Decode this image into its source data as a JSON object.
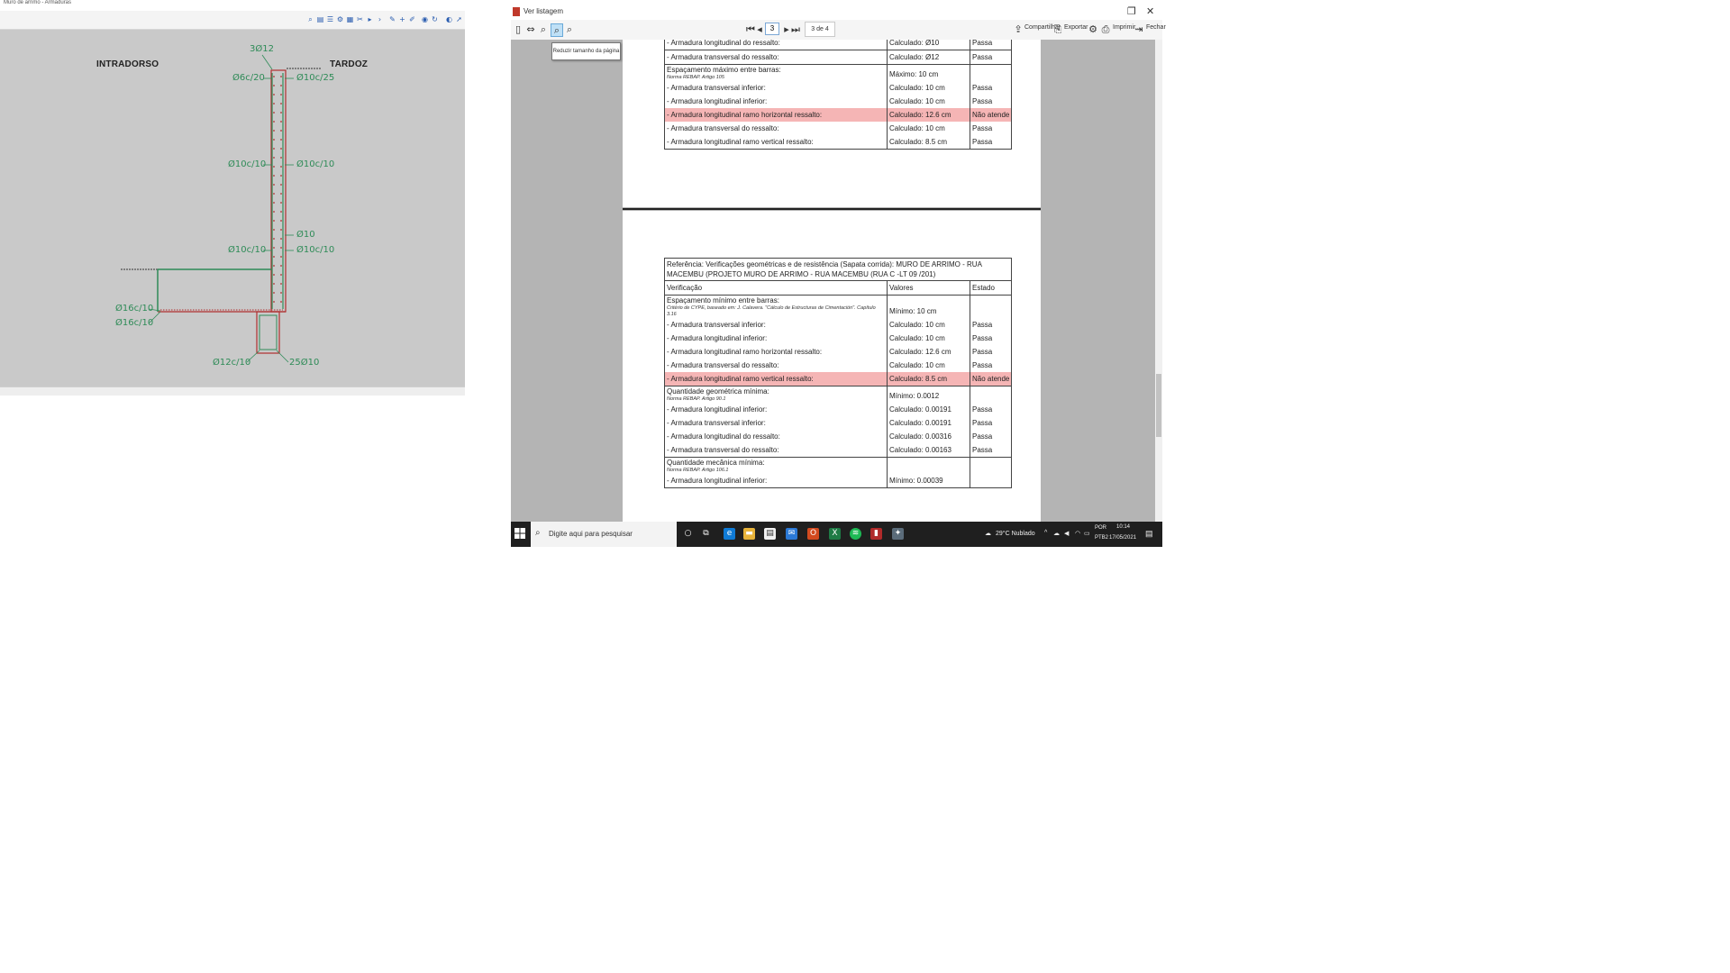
{
  "cad": {
    "window_title": "Muro de arrimo - Armaduras",
    "side_left": "INTRADORSO",
    "side_right": "TARDOZ",
    "labels": {
      "top_bars": "3Ø12",
      "stem_top_left": "Ø6c/20",
      "stem_top_right": "Ø10c/25",
      "stem_mid_left": "Ø10c/10",
      "stem_mid_right": "Ø10c/10",
      "stem_bar": "Ø10",
      "stem_low_left": "Ø10c/10",
      "stem_low_right": "Ø10c/10",
      "footing_1": "Ø16c/10",
      "footing_2": "Ø16c/10",
      "key_left": "Ø12c/10",
      "key_right": "25Ø10"
    },
    "colors": {
      "canvas": "#c9c9c9",
      "rebar": "#2e8b57",
      "concrete": "#b03030"
    }
  },
  "viewer": {
    "title": "Ver listagem",
    "current_page": "3",
    "page_count": "3 de 4",
    "tooltip": "Reduzir tamanho da página",
    "actions": {
      "share": "Compartilhar",
      "export": "Exportar",
      "print": "Imprimir...",
      "close": "Fechar"
    },
    "table_a": {
      "top_rows": [
        {
          "label": "- Armadura longitudinal do ressalto:",
          "value": "Calculado: Ø10",
          "status": "Passa"
        },
        {
          "label": "- Armadura transversal do ressalto:",
          "value": "Calculado: Ø12",
          "status": "Passa"
        }
      ],
      "group_title": "Espaçamento máximo entre barras:",
      "group_norm": "Norma REBAP. Artigo 105",
      "group_value": "Máximo: 10 cm",
      "rows": [
        {
          "label": "- Armadura transversal inferior:",
          "value": "Calculado: 10 cm",
          "status": "Passa",
          "fail": false
        },
        {
          "label": "- Armadura longitudinal inferior:",
          "value": "Calculado: 10 cm",
          "status": "Passa",
          "fail": false
        },
        {
          "label": "- Armadura longitudinal ramo horizontal ressalto:",
          "value": "Calculado: 12.6 cm",
          "status": "Não atende",
          "fail": true
        },
        {
          "label": "- Armadura transversal do ressalto:",
          "value": "Calculado: 10 cm",
          "status": "Passa",
          "fail": false
        },
        {
          "label": "- Armadura longitudinal ramo vertical ressalto:",
          "value": "Calculado: 8.5 cm",
          "status": "Passa",
          "fail": false
        }
      ]
    },
    "table_b": {
      "reference": "Referência: Verificações geométricas e de resistência (Sapata corrida): MURO DE ARRIMO - RUA MACEMBU (PROJETO MURO DE ARRIMO - RUA MACEMBU (RUA C -LT 09 /201)",
      "headers": {
        "check": "Verificação",
        "values": "Valores",
        "state": "Estado"
      },
      "group1_title": "Espaçamento mínimo entre barras:",
      "group1_norm": "Critério de CYPE, baseado em: J. Calavera. \"Cálculo de Estructuras de Cimentación\". Capítulo 3.16",
      "group1_value": "Mínimo: 10 cm",
      "group1_rows": [
        {
          "label": "- Armadura transversal inferior:",
          "value": "Calculado: 10 cm",
          "status": "Passa",
          "fail": false
        },
        {
          "label": "- Armadura longitudinal inferior:",
          "value": "Calculado: 10 cm",
          "status": "Passa",
          "fail": false
        },
        {
          "label": "- Armadura longitudinal ramo horizontal ressalto:",
          "value": "Calculado: 12.6 cm",
          "status": "Passa",
          "fail": false
        },
        {
          "label": "- Armadura transversal do ressalto:",
          "value": "Calculado: 10 cm",
          "status": "Passa",
          "fail": false
        },
        {
          "label": "- Armadura longitudinal ramo vertical ressalto:",
          "value": "Calculado: 8.5 cm",
          "status": "Não atende",
          "fail": true
        }
      ],
      "group2_title": "Quantidade geométrica mínima:",
      "group2_norm": "Norma REBAP. Artigo 90.1",
      "group2_value": "Mínimo: 0.0012",
      "group2_rows": [
        {
          "label": "- Armadura longitudinal inferior:",
          "value": "Calculado: 0.00191",
          "status": "Passa"
        },
        {
          "label": "- Armadura transversal inferior:",
          "value": "Calculado: 0.00191",
          "status": "Passa"
        },
        {
          "label": "- Armadura longitudinal do ressalto:",
          "value": "Calculado: 0.00316",
          "status": "Passa"
        },
        {
          "label": "- Armadura transversal do ressalto:",
          "value": "Calculado: 0.00163",
          "status": "Passa"
        }
      ],
      "group3_title": "Quantidade mecânica mínima:",
      "group3_norm": "Norma REBAP. Artigo 106.1",
      "group3_rows": [
        {
          "label": "- Armadura longitudinal inferior:",
          "value": "Mínimo: 0.00039",
          "status": ""
        }
      ]
    },
    "colors": {
      "fail_row": "#f5b5b5"
    }
  },
  "taskbar": {
    "search_placeholder": "Digite aqui para pesquisar",
    "weather": "29°C Nublado",
    "lang_top": "POR",
    "lang_bottom": "PTB2",
    "time": "10:14",
    "date": "17/05/2021"
  }
}
